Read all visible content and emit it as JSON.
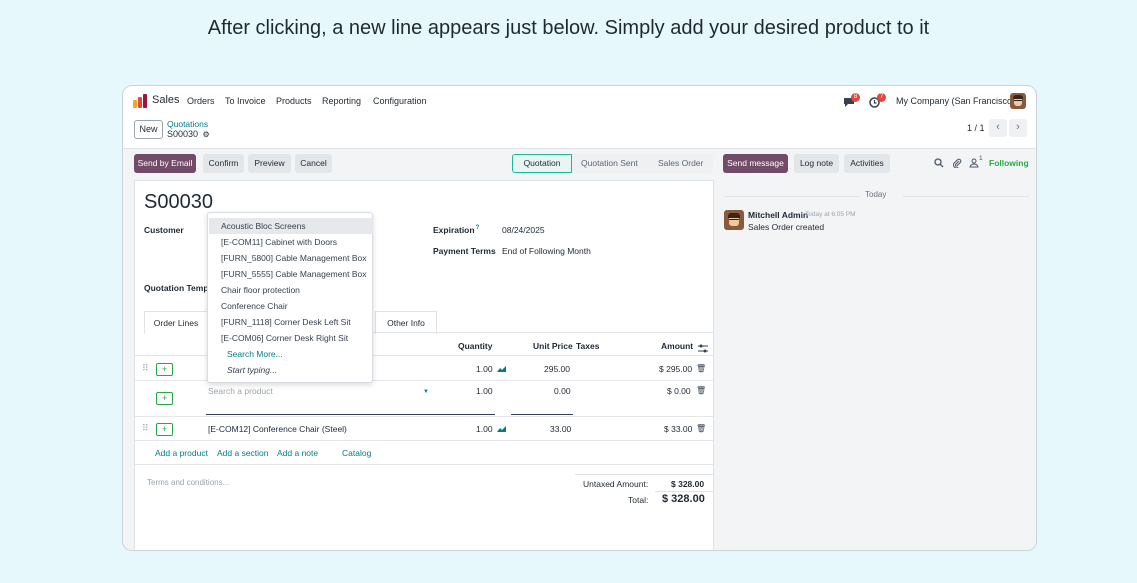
{
  "caption": "After clicking, a new line appears just below. Simply add your desired product to it",
  "nav": {
    "app": "Sales",
    "menu": [
      "Orders",
      "To Invoice",
      "Products",
      "Reporting",
      "Configuration"
    ],
    "messages_badge": "8",
    "activities_badge": "7",
    "company": "My Company (San Francisco)"
  },
  "breadcrumb": {
    "new_label": "New",
    "parent": "Quotations",
    "current": "S00030",
    "pager": "1 / 1"
  },
  "actions": {
    "send_by_email": "Send by Email",
    "confirm": "Confirm",
    "preview": "Preview",
    "cancel": "Cancel"
  },
  "statusbar": [
    "Quotation",
    "Quotation Sent",
    "Sales Order"
  ],
  "chatter_actions": {
    "send_message": "Send message",
    "log_note": "Log note",
    "activities": "Activities",
    "followers_count": "1",
    "following": "Following"
  },
  "form": {
    "title": "S00030",
    "customer_label": "Customer",
    "expiration_label": "Expiration",
    "expiration_help": "?",
    "expiration_value": "08/24/2025",
    "payment_terms_label": "Payment Terms",
    "payment_terms_value": "End of Following Month",
    "quotation_template_label": "Quotation Templ"
  },
  "tabs": [
    "Order Lines",
    "Other Info"
  ],
  "table": {
    "headers": {
      "quantity": "Quantity",
      "unit_price": "Unit Price",
      "taxes": "Taxes",
      "amount": "Amount"
    },
    "rows": [
      {
        "product": "",
        "quantity": "1.00",
        "unit_price": "295.00",
        "amount": "$ 295.00"
      },
      {
        "product": "",
        "placeholder": "Search a product",
        "quantity": "1.00",
        "unit_price": "0.00",
        "amount": "$ 0.00"
      },
      {
        "product": "[E-COM12] Conference Chair (Steel)",
        "quantity": "1.00",
        "unit_price": "33.00",
        "amount": "$ 33.00"
      }
    ],
    "links": [
      "Add a product",
      "Add a section",
      "Add a note",
      "Catalog"
    ]
  },
  "dropdown": {
    "items": [
      "Acoustic Bloc Screens",
      "[E-COM11] Cabinet with Doors",
      "[FURN_5800] Cable Management Box",
      "[FURN_5555] Cable Management Box",
      "Chair floor protection",
      "Conference Chair",
      "[FURN_1118] Corner Desk Left Sit",
      "[E-COM06] Corner Desk Right Sit"
    ],
    "search_more": "Search More...",
    "start_typing": "Start typing..."
  },
  "footer": {
    "terms_placeholder": "Terms and conditions...",
    "untaxed_label": "Untaxed Amount:",
    "untaxed_value": "$ 328.00",
    "total_label": "Total:",
    "total_value": "$ 328.00"
  },
  "chatter": {
    "day": "Today",
    "author": "Mitchell Admin",
    "time": "Today at 6:05 PM",
    "body": "Sales Order created"
  },
  "colors": {
    "primary": "#714b67",
    "link": "#017e84",
    "success": "#28a745",
    "background": "#e6f8fc"
  }
}
